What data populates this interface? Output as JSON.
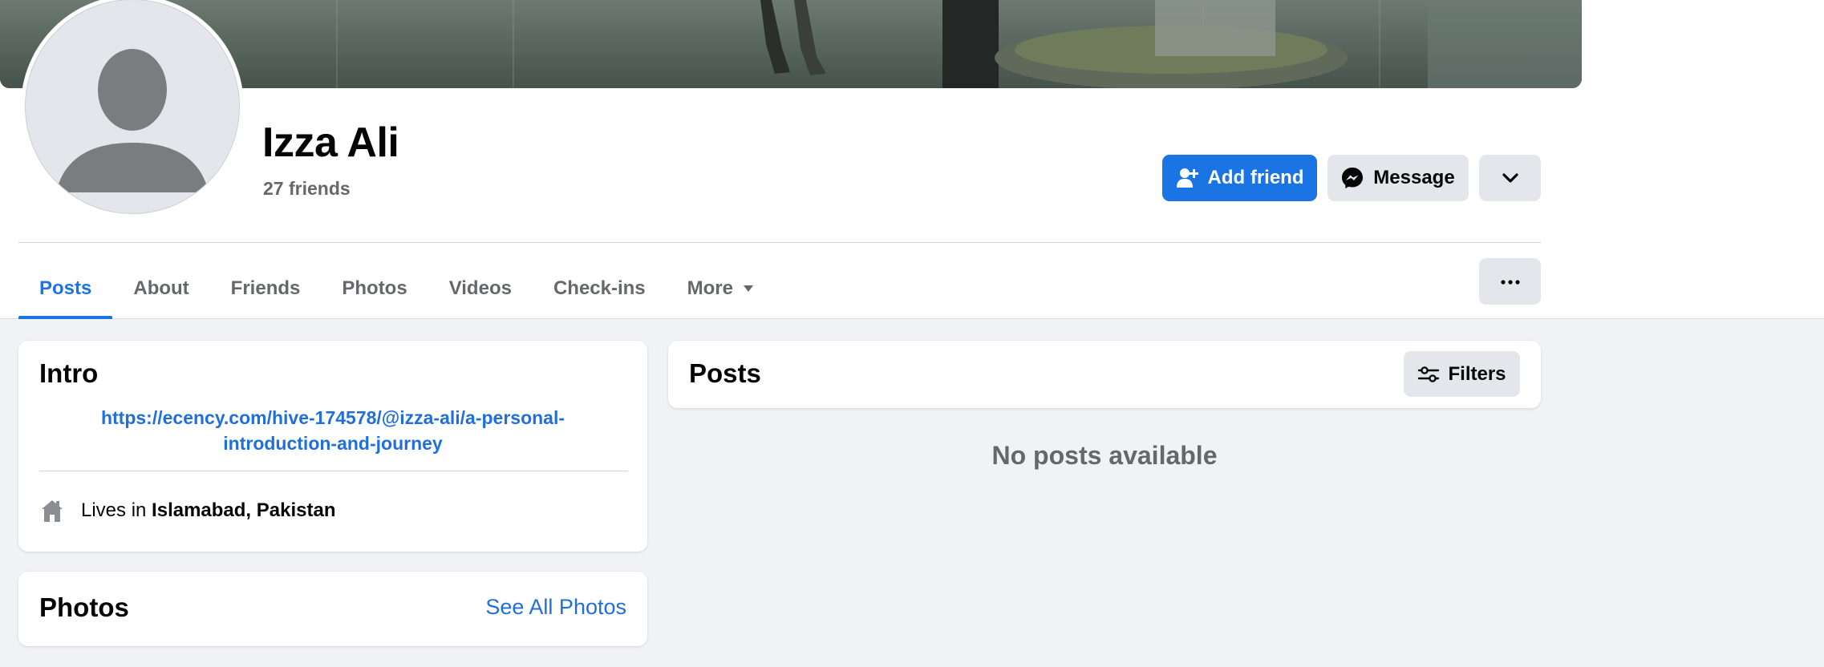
{
  "profile": {
    "name": "Izza Ali",
    "friends_count": "27 friends"
  },
  "actions": {
    "add_friend": "Add friend",
    "message": "Message"
  },
  "tabs": [
    {
      "label": "Posts",
      "active": true
    },
    {
      "label": "About"
    },
    {
      "label": "Friends"
    },
    {
      "label": "Photos"
    },
    {
      "label": "Videos"
    },
    {
      "label": "Check-ins"
    },
    {
      "label": "More"
    }
  ],
  "intro": {
    "title": "Intro",
    "link_line1": "https://ecency.com/hive-174578/@izza-ali/a-personal-",
    "link_line2": "introduction-and-journey",
    "lives_prefix": "Lives in ",
    "lives_city": "Islamabad, Pakistan"
  },
  "photos": {
    "title": "Photos",
    "see_all": "See All Photos"
  },
  "posts": {
    "title": "Posts",
    "filters": "Filters",
    "empty": "No posts available"
  },
  "colors": {
    "accent": "#1b74e4",
    "link": "#216fdb",
    "secondary_text": "#65676b",
    "background": "#f0f2f5"
  },
  "icons": {
    "add_friend": "person-plus-icon",
    "message": "messenger-icon",
    "dropdown": "chevron-down-icon",
    "more_menu": "ellipsis-icon",
    "home": "home-icon",
    "filters": "sliders-icon"
  }
}
